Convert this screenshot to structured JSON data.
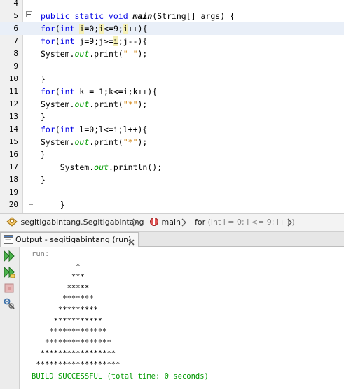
{
  "editor": {
    "lines": [
      {
        "num": "4",
        "code": []
      },
      {
        "num": "5",
        "code": [
          {
            "t": "public static void ",
            "c": "kw"
          },
          {
            "t": "main",
            "c": "meth"
          },
          {
            "t": "(String[] args) {",
            "c": ""
          }
        ]
      },
      {
        "num": "6",
        "current": true,
        "code": [
          {
            "t": "",
            "c": "caret"
          },
          {
            "t": "for",
            "c": "kw"
          },
          {
            "t": "(",
            "c": ""
          },
          {
            "t": "int",
            "c": "kw"
          },
          {
            "t": " ",
            "c": ""
          },
          {
            "t": "i",
            "c": "hl"
          },
          {
            "t": "=0;",
            "c": ""
          },
          {
            "t": "i",
            "c": "hl"
          },
          {
            "t": "<=9;",
            "c": ""
          },
          {
            "t": "i",
            "c": "hl"
          },
          {
            "t": "++){",
            "c": ""
          }
        ]
      },
      {
        "num": "7",
        "code": [
          {
            "t": "for",
            "c": "kw"
          },
          {
            "t": "(",
            "c": ""
          },
          {
            "t": "int",
            "c": "kw"
          },
          {
            "t": " j=9;j>=",
            "c": ""
          },
          {
            "t": "i",
            "c": "hl"
          },
          {
            "t": ";j--){",
            "c": ""
          }
        ]
      },
      {
        "num": "8",
        "code": [
          {
            "t": "System.",
            "c": ""
          },
          {
            "t": "out",
            "c": "fld"
          },
          {
            "t": ".print(",
            "c": ""
          },
          {
            "t": "\" \"",
            "c": "str"
          },
          {
            "t": ");",
            "c": ""
          }
        ]
      },
      {
        "num": "9",
        "code": []
      },
      {
        "num": "10",
        "code": [
          {
            "t": "}",
            "c": ""
          }
        ]
      },
      {
        "num": "11",
        "code": [
          {
            "t": "for",
            "c": "kw"
          },
          {
            "t": "(",
            "c": ""
          },
          {
            "t": "int",
            "c": "kw"
          },
          {
            "t": " k = 1;k<=i;k++){",
            "c": ""
          }
        ]
      },
      {
        "num": "12",
        "code": [
          {
            "t": "System.",
            "c": ""
          },
          {
            "t": "out",
            "c": "fld"
          },
          {
            "t": ".print(",
            "c": ""
          },
          {
            "t": "\"*\"",
            "c": "str"
          },
          {
            "t": ");",
            "c": ""
          }
        ]
      },
      {
        "num": "13",
        "code": [
          {
            "t": "}",
            "c": ""
          }
        ]
      },
      {
        "num": "14",
        "code": [
          {
            "t": "for",
            "c": "kw"
          },
          {
            "t": "(",
            "c": ""
          },
          {
            "t": "int",
            "c": "kw"
          },
          {
            "t": " l=0;l<=i;l++){",
            "c": ""
          }
        ]
      },
      {
        "num": "15",
        "code": [
          {
            "t": "System.",
            "c": ""
          },
          {
            "t": "out",
            "c": "fld"
          },
          {
            "t": ".print(",
            "c": ""
          },
          {
            "t": "\"*\"",
            "c": "str"
          },
          {
            "t": ");",
            "c": ""
          }
        ]
      },
      {
        "num": "16",
        "code": [
          {
            "t": "}",
            "c": ""
          }
        ]
      },
      {
        "num": "17",
        "code": [
          {
            "t": "    System.",
            "c": ""
          },
          {
            "t": "out",
            "c": "fld"
          },
          {
            "t": ".println();",
            "c": ""
          }
        ]
      },
      {
        "num": "18",
        "code": [
          {
            "t": "}",
            "c": ""
          }
        ]
      },
      {
        "num": "19",
        "code": []
      },
      {
        "num": "20",
        "code": [
          {
            "t": "    }",
            "c": ""
          }
        ]
      }
    ]
  },
  "breadcrumbs": {
    "class_label": "segitigabintang.Segitigabintang",
    "method_label": "main",
    "loop_keyword": "for",
    "loop_rest": "(int i = 0; i <= 9; i++)"
  },
  "output": {
    "tab_label": "Output - segitigabintang (run)",
    "run_label": "run:",
    "star_lines": [
      "          *",
      "         ***",
      "        *****",
      "       *******",
      "      *********",
      "     ***********",
      "    *************",
      "   ***************",
      "  *****************",
      " *******************"
    ],
    "build_message": "BUILD SUCCESSFUL (total time: 0 seconds)"
  },
  "colors": {
    "keyword": "#0000e6",
    "string": "#ce7b00",
    "field": "#009900",
    "build_success": "#009900",
    "current_line": "#e9eff8",
    "highlight": "#f5f0b5"
  },
  "icons": {
    "fold_toggle": "minus-box-icon",
    "class_crumb": "class-icon",
    "method_crumb": "method-icon",
    "crumb_separator": "chevron-right-icon",
    "output_tab": "output-window-icon",
    "close": "close-icon",
    "rerun": "rerun-icon",
    "rerun_with_options": "rerun-with-options-icon",
    "stop": "stop-icon",
    "settings": "settings-icon"
  }
}
